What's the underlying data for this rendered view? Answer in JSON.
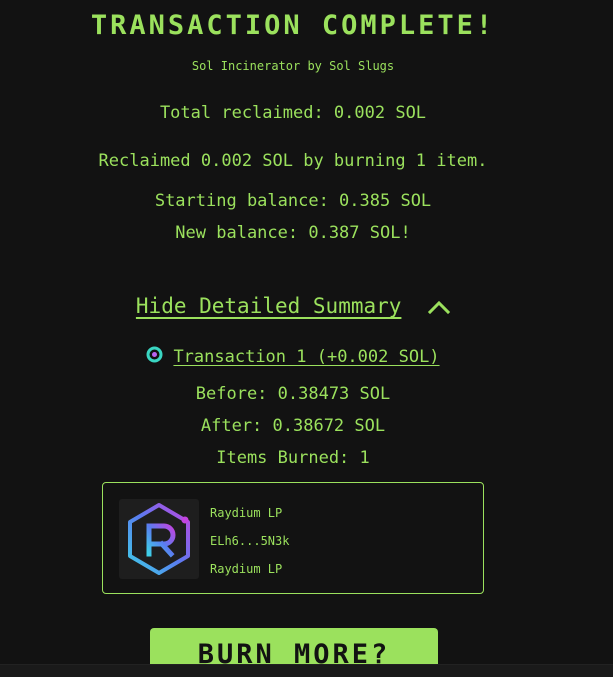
{
  "header": {
    "title": "TRANSACTION COMPLETE!",
    "subtitle": "Sol Incinerator by Sol Slugs"
  },
  "summary": {
    "total_reclaimed": "Total reclaimed: 0.002 SOL",
    "reclaimed_detail": "Reclaimed 0.002 SOL by burning 1 item.",
    "starting_balance": "Starting balance: 0.385 SOL",
    "new_balance": "New balance: 0.387 SOL!"
  },
  "details_toggle": {
    "label": "Hide Detailed Summary",
    "icon": "chevron-up-icon"
  },
  "transactions": [
    {
      "label": "Transaction 1 (+0.002 SOL)",
      "before": "Before: 0.38473 SOL",
      "after": "After: 0.38672 SOL",
      "items_burned": "Items Burned: 1",
      "items": [
        {
          "name": "Raydium LP",
          "address": "ELh6...5N3k",
          "collection": "Raydium LP",
          "icon": "raydium-logo-icon"
        }
      ]
    }
  ],
  "actions": {
    "burn_more": "BURN MORE?"
  },
  "colors": {
    "background": "#121212",
    "accent": "#9be15d",
    "tx_icon": "#3ad6c2"
  }
}
